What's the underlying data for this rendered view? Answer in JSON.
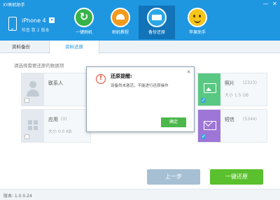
{
  "app": {
    "title": "XY刷机助手",
    "window_controls": [
      "—",
      "✕"
    ]
  },
  "device": {
    "name": "iPhone 4",
    "dropdown_glyph": "▾",
    "status": "检查 数 2 版本"
  },
  "nav": {
    "items": [
      {
        "label": "一键刷机",
        "icon": "refresh-icon",
        "color": "#37b34a",
        "active": false
      },
      {
        "label": "刷机教程",
        "icon": "lamp-icon",
        "color": "#f39a1c",
        "active": false
      },
      {
        "label": "备份还原",
        "icon": "backup-drive-icon",
        "color": "#2aa7e8",
        "active": true
      },
      {
        "label": "苹果助手",
        "icon": "smiley-icon",
        "color": "#f5c518",
        "active": false
      }
    ]
  },
  "tabs": [
    {
      "label": "资料备份",
      "active": false
    },
    {
      "label": "资料还原",
      "active": true
    }
  ],
  "main": {
    "title": "请选择需要还原的数据项"
  },
  "cards": {
    "contacts": {
      "label": "联系人",
      "count": "(0)",
      "size": "",
      "checked": false,
      "icon": "contact-icon"
    },
    "apps": {
      "label": "应用",
      "count": "(0)",
      "size": "大小 0.0 KB",
      "checked": false,
      "icon": "apps-icon"
    },
    "photos": {
      "label": "照片",
      "count": "(2323)",
      "size": "大小 1.5 GB",
      "checked": true,
      "icon": "photo-icon"
    },
    "sms": {
      "label": "短信",
      "count": "(5344)",
      "size": "",
      "checked": true,
      "icon": "sms-icon"
    }
  },
  "modal": {
    "title": "还原提醒:",
    "message": "设备尚未激活，不能进行还原操作",
    "close": "×",
    "alert_glyph": "!",
    "ok_label": "确定"
  },
  "buttons": {
    "prev_label": "上一步",
    "restore_label": "一键还原"
  },
  "footer": {
    "version": "版本: 1.0.0.24"
  },
  "colors": {
    "header": "#1f96e0",
    "accent_green": "#5ac02d",
    "disabled_blue": "#a6bfd3",
    "alert_red": "#e0462e"
  }
}
